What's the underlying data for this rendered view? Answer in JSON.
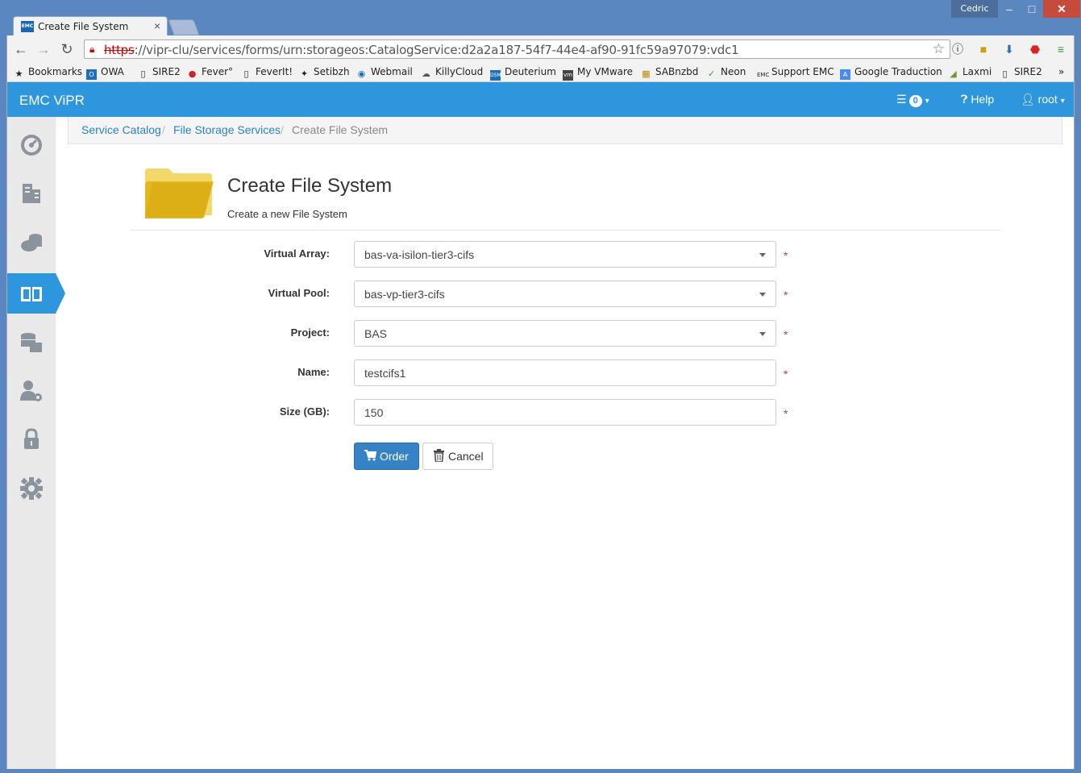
{
  "browser": {
    "tab_title": "Create File System",
    "tab_favicon": "EMC",
    "user": "Cedric",
    "url_scheme": "https",
    "url_rest": "://vipr-clu/services/forms/urn:storageos:CatalogService:d2a2a187-54f7-44e4-af90-91fc59a97079:vdc1",
    "bookmarks": [
      "Bookmarks",
      "OWA",
      "SIRE2",
      "Fever°",
      "FeverIt!",
      "Setibzh",
      "Webmail",
      "KillyCloud",
      "Deuterium",
      "My VMware",
      "SABnzbd",
      "Neon",
      "Support EMC",
      "Google Traduction",
      "Laxmi",
      "SIRE2"
    ],
    "overflow": "»"
  },
  "app": {
    "brand": "EMC ViPR",
    "notifications_count": "0",
    "help_label": "Help",
    "user_label": "root"
  },
  "sidebar": {
    "icons": [
      "dashboard-icon",
      "resources-icon",
      "virtual-storage-icon",
      "catalog-icon",
      "storage-icon",
      "users-settings-icon",
      "security-icon",
      "settings-icon"
    ],
    "active": "catalog-icon"
  },
  "breadcrumb": {
    "items": [
      "Service Catalog",
      "File Storage Services",
      "Create File System"
    ],
    "separator": "/"
  },
  "page": {
    "title": "Create File System",
    "subtitle": "Create a new File System"
  },
  "form": {
    "virtual_array": {
      "label": "Virtual Array:",
      "value": "bas-va-isilon-tier3-cifs"
    },
    "virtual_pool": {
      "label": "Virtual Pool:",
      "value": "bas-vp-tier3-cifs"
    },
    "project": {
      "label": "Project:",
      "value": "BAS"
    },
    "name": {
      "label": "Name:",
      "value": "testcifs1"
    },
    "size": {
      "label": "Size (GB):",
      "value": "150"
    },
    "required_marker": "*",
    "order_label": "Order",
    "cancel_label": "Cancel"
  },
  "colors": {
    "navbar": "#2d96dc",
    "primary_button": "#3583c6",
    "window_frame": "#5b87c0",
    "required": "#a94442"
  }
}
